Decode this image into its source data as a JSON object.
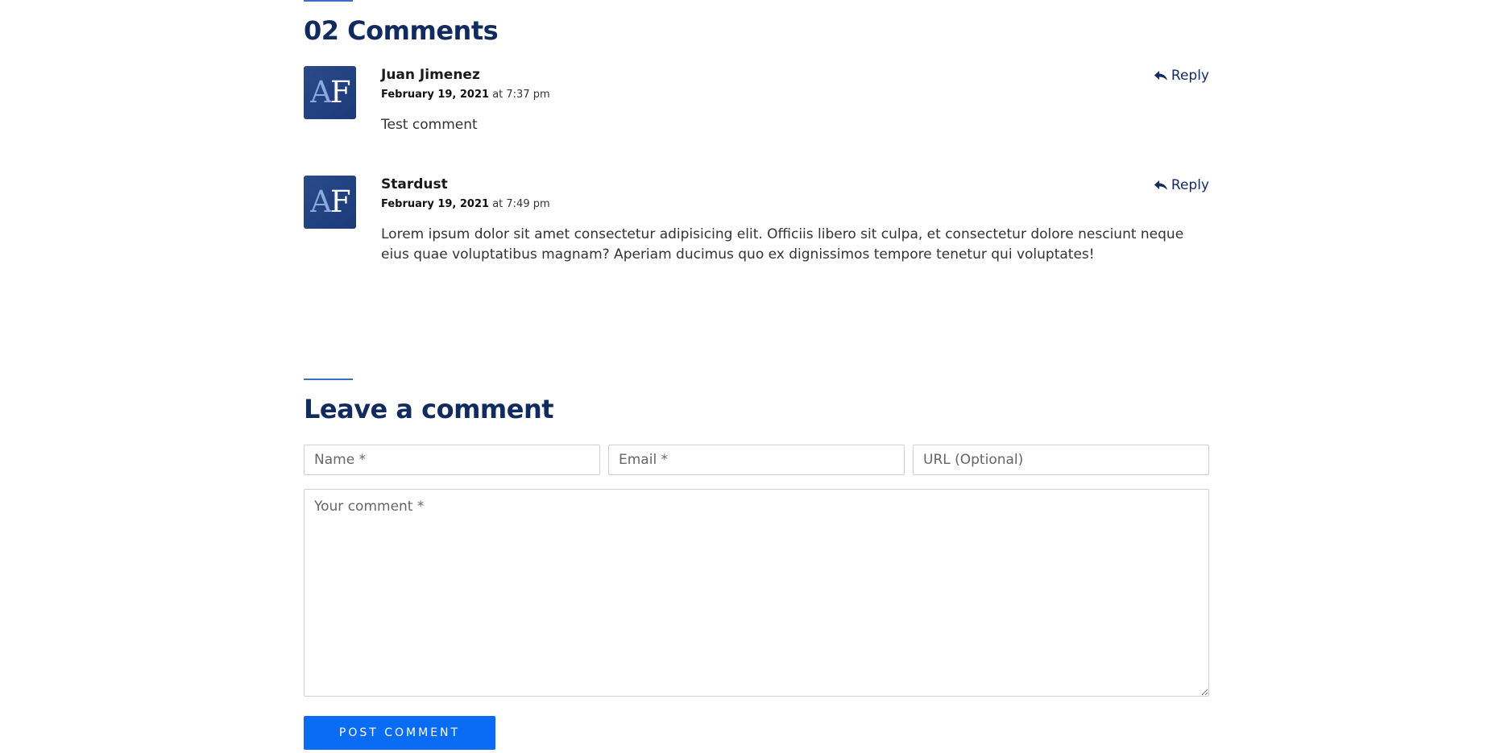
{
  "comments_section": {
    "title": "02 Comments",
    "comments": [
      {
        "avatar": "AF",
        "avatar_a": "A",
        "avatar_f": "F",
        "author": "Juan Jimenez",
        "date": "February 19, 2021",
        "time": "at 7:37 pm",
        "text": "Test comment",
        "reply_label": "Reply"
      },
      {
        "avatar": "AF",
        "avatar_a": "A",
        "avatar_f": "F",
        "author": "Stardust",
        "date": "February 19, 2021",
        "time": "at 7:49 pm",
        "text": "Lorem ipsum dolor sit amet consectetur adipisicing elit. Officiis libero sit culpa, et consectetur dolore nesciunt neque eius quae voluptatibus magnam? Aperiam ducimus quo ex dignissimos tempore tenetur qui voluptates!",
        "reply_label": "Reply"
      }
    ]
  },
  "comment_form": {
    "title": "Leave a comment",
    "name_placeholder": "Name *",
    "email_placeholder": "Email *",
    "url_placeholder": "URL (Optional)",
    "comment_placeholder": "Your comment *",
    "submit_label": "POST COMMENT"
  },
  "icons": {
    "reply": "reply-arrow-icon"
  },
  "colors": {
    "heading": "#112b5f",
    "accent_line": "#3f6cc4",
    "button": "#0a6cf5",
    "avatar_bg": "#1c3a78"
  }
}
